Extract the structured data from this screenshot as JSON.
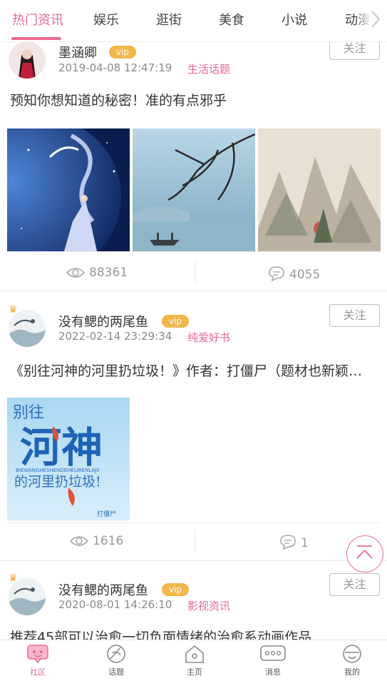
{
  "tabs": [
    "热门资讯",
    "娱乐",
    "逛街",
    "美食",
    "小说",
    "动漫"
  ],
  "active_tab": 0,
  "posts": [
    {
      "author": "墨涵卿",
      "vip": "vip",
      "date": "2019-04-08 12:47:19",
      "topic": "生活话题",
      "follow": "关注",
      "title": "预知你想知道的秘密！准的有点邪乎",
      "views": "88361",
      "comments": "4055"
    },
    {
      "author": "没有鳃的两尾鱼",
      "vip": "vip",
      "date": "2022-02-14 23:29:34",
      "topic": "纯爱好书",
      "follow": "关注",
      "title": "《别往河神的河里扔垃圾！》作者：打僵尸（题材也新颖…",
      "views": "1616",
      "comments": "1",
      "cover": {
        "title_line1": "别往",
        "title_big": "河神",
        "title_line3": "的河里扔垃圾!",
        "pinyin": "BIEWANGHESHENDEHELIRENLAJI!",
        "author_mark": "打僵尸"
      }
    },
    {
      "author": "没有鳃的两尾鱼",
      "vip": "vip",
      "date": "2020-08-01 14:26:10",
      "topic": "影视资讯",
      "follow": "关注",
      "title": "推荐45部可以治愈一切负面情绪的治愈系动画作品"
    }
  ],
  "nav": [
    {
      "label": "社区",
      "icon": "community-icon"
    },
    {
      "label": "话题",
      "icon": "topic-icon"
    },
    {
      "label": "主页",
      "icon": "home-icon"
    },
    {
      "label": "消息",
      "icon": "message-icon"
    },
    {
      "label": "我的",
      "icon": "profile-icon"
    }
  ],
  "colors": {
    "accent": "#e86a95",
    "vip": "#f2b64a",
    "muted": "#8a8a8a"
  }
}
